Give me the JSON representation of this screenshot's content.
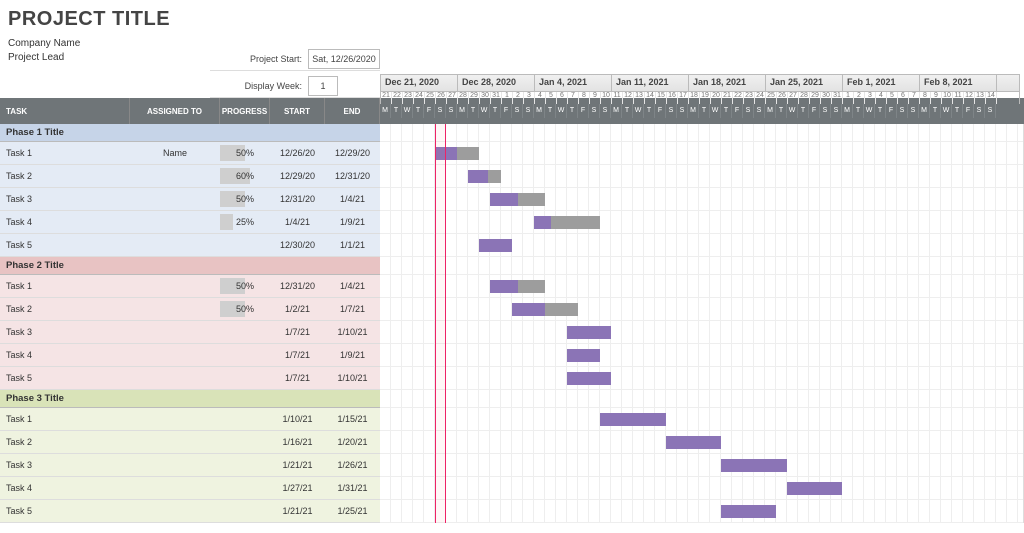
{
  "title": "PROJECT TITLE",
  "meta": {
    "company": "Company Name",
    "lead": "Project Lead"
  },
  "inputs": {
    "project_start_label": "Project Start:",
    "project_start_value": "Sat, 12/26/2020",
    "display_week_label": "Display Week:",
    "display_week_value": "1"
  },
  "columns": {
    "task": "TASK",
    "assigned": "ASSIGNED TO",
    "progress": "PROGRESS",
    "start": "START",
    "end": "END"
  },
  "calendar": {
    "first_day_offset": 0,
    "today_index": 5,
    "weeks": [
      "Dec 21, 2020",
      "Dec 28, 2020",
      "Jan 4, 2021",
      "Jan 11, 2021",
      "Jan 18, 2021",
      "Jan 25, 2021",
      "Feb 1, 2021",
      "Feb 8, 2021"
    ],
    "day_numbers": [
      "21",
      "22",
      "23",
      "24",
      "25",
      "26",
      "27",
      "28",
      "29",
      "30",
      "31",
      "1",
      "2",
      "3",
      "4",
      "5",
      "6",
      "7",
      "8",
      "9",
      "10",
      "11",
      "12",
      "13",
      "14",
      "15",
      "16",
      "17",
      "18",
      "19",
      "20",
      "21",
      "22",
      "23",
      "24",
      "25",
      "26",
      "27",
      "28",
      "29",
      "30",
      "31",
      "1",
      "2",
      "3",
      "4",
      "5",
      "6",
      "7",
      "8",
      "9",
      "10",
      "11",
      "12",
      "13",
      "14"
    ],
    "dow": [
      "M",
      "T",
      "W",
      "T",
      "F",
      "S",
      "S",
      "M",
      "T",
      "W",
      "T",
      "F",
      "S",
      "S",
      "M",
      "T",
      "W",
      "T",
      "F",
      "S",
      "S",
      "M",
      "T",
      "W",
      "T",
      "F",
      "S",
      "S",
      "M",
      "T",
      "W",
      "T",
      "F",
      "S",
      "S",
      "M",
      "T",
      "W",
      "T",
      "F",
      "S",
      "S",
      "M",
      "T",
      "W",
      "T",
      "F",
      "S",
      "S",
      "M",
      "T",
      "W",
      "T",
      "F",
      "S",
      "S"
    ]
  },
  "phases": [
    {
      "title": "Phase 1 Title",
      "color": "blue",
      "tasks": [
        {
          "name": "Task 1",
          "assigned": "Name",
          "progress": "50%",
          "progress_pct": 50,
          "start": "12/26/20",
          "end": "12/29/20",
          "bar_start": 5,
          "bar_len": 4
        },
        {
          "name": "Task 2",
          "assigned": "",
          "progress": "60%",
          "progress_pct": 60,
          "start": "12/29/20",
          "end": "12/31/20",
          "bar_start": 8,
          "bar_len": 3
        },
        {
          "name": "Task 3",
          "assigned": "",
          "progress": "50%",
          "progress_pct": 50,
          "start": "12/31/20",
          "end": "1/4/21",
          "bar_start": 10,
          "bar_len": 5
        },
        {
          "name": "Task 4",
          "assigned": "",
          "progress": "25%",
          "progress_pct": 25,
          "start": "1/4/21",
          "end": "1/9/21",
          "bar_start": 14,
          "bar_len": 6
        },
        {
          "name": "Task 5",
          "assigned": "",
          "progress": "",
          "progress_pct": 100,
          "start": "12/30/20",
          "end": "1/1/21",
          "bar_start": 9,
          "bar_len": 3
        }
      ]
    },
    {
      "title": "Phase 2 Title",
      "color": "pink",
      "tasks": [
        {
          "name": "Task 1",
          "assigned": "",
          "progress": "50%",
          "progress_pct": 50,
          "start": "12/31/20",
          "end": "1/4/21",
          "bar_start": 10,
          "bar_len": 5
        },
        {
          "name": "Task 2",
          "assigned": "",
          "progress": "50%",
          "progress_pct": 50,
          "start": "1/2/21",
          "end": "1/7/21",
          "bar_start": 12,
          "bar_len": 6
        },
        {
          "name": "Task 3",
          "assigned": "",
          "progress": "",
          "progress_pct": 100,
          "start": "1/7/21",
          "end": "1/10/21",
          "bar_start": 17,
          "bar_len": 4
        },
        {
          "name": "Task 4",
          "assigned": "",
          "progress": "",
          "progress_pct": 100,
          "start": "1/7/21",
          "end": "1/9/21",
          "bar_start": 17,
          "bar_len": 3
        },
        {
          "name": "Task 5",
          "assigned": "",
          "progress": "",
          "progress_pct": 100,
          "start": "1/7/21",
          "end": "1/10/21",
          "bar_start": 17,
          "bar_len": 4
        }
      ]
    },
    {
      "title": "Phase 3 Title",
      "color": "green",
      "tasks": [
        {
          "name": "Task 1",
          "assigned": "",
          "progress": "",
          "progress_pct": 100,
          "start": "1/10/21",
          "end": "1/15/21",
          "bar_start": 20,
          "bar_len": 6
        },
        {
          "name": "Task 2",
          "assigned": "",
          "progress": "",
          "progress_pct": 100,
          "start": "1/16/21",
          "end": "1/20/21",
          "bar_start": 26,
          "bar_len": 5
        },
        {
          "name": "Task 3",
          "assigned": "",
          "progress": "",
          "progress_pct": 100,
          "start": "1/21/21",
          "end": "1/26/21",
          "bar_start": 31,
          "bar_len": 6
        },
        {
          "name": "Task 4",
          "assigned": "",
          "progress": "",
          "progress_pct": 100,
          "start": "1/27/21",
          "end": "1/31/21",
          "bar_start": 37,
          "bar_len": 5
        },
        {
          "name": "Task 5",
          "assigned": "",
          "progress": "",
          "progress_pct": 100,
          "start": "1/21/21",
          "end": "1/25/21",
          "bar_start": 31,
          "bar_len": 5
        }
      ]
    }
  ]
}
